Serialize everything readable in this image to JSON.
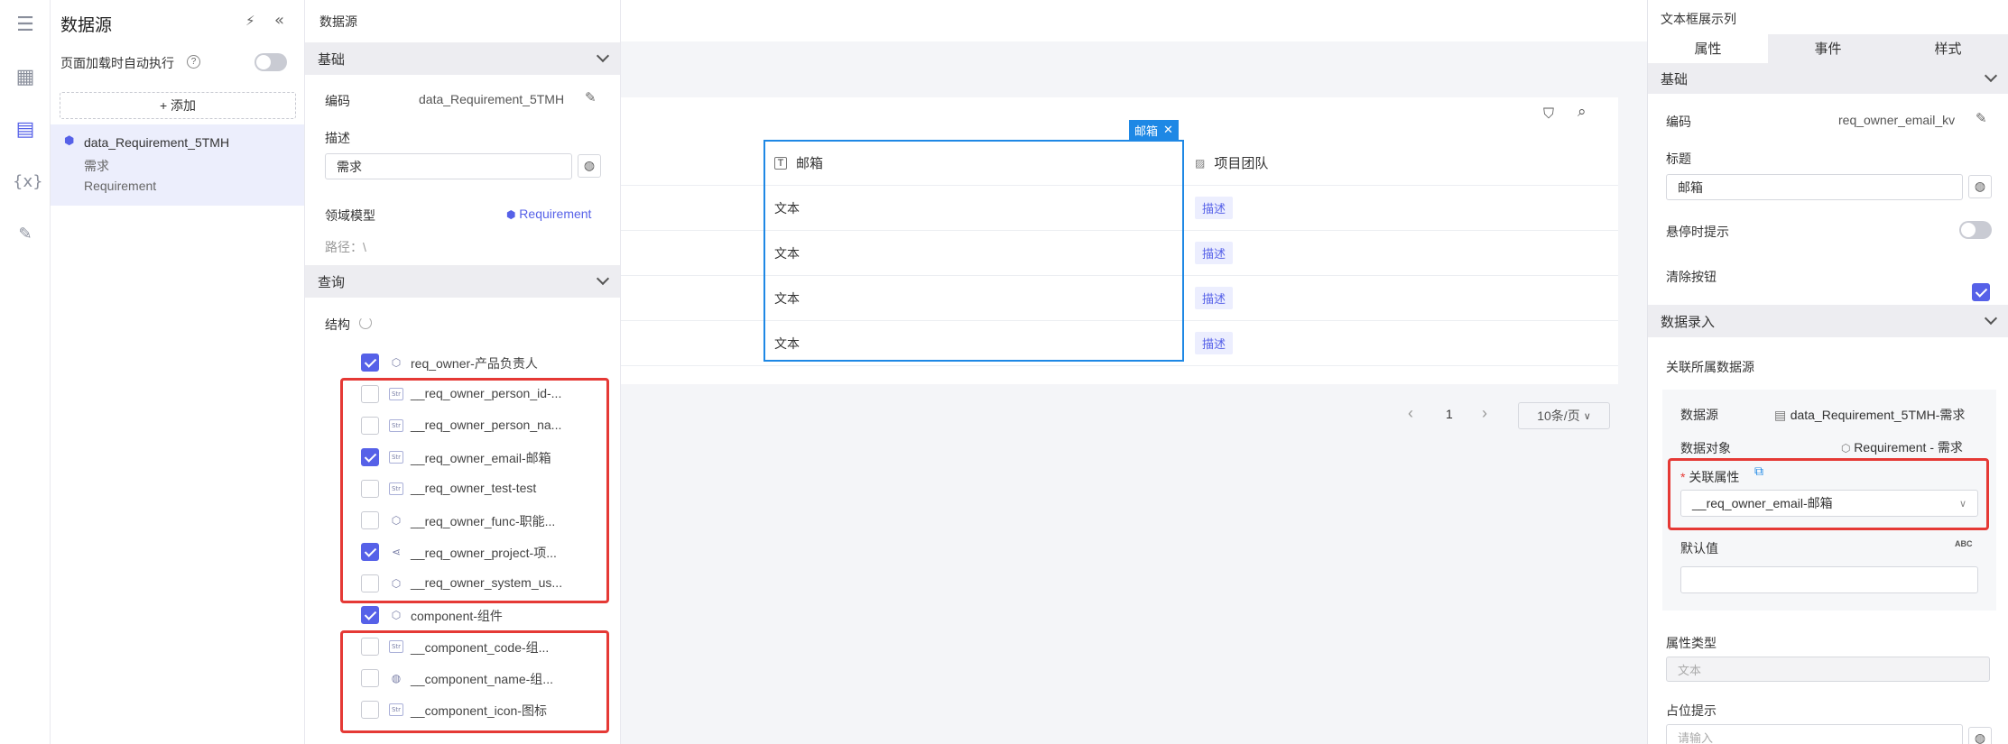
{
  "datasource_panel": {
    "title": "数据源",
    "auto_exec_label": "页面加载时自动执行",
    "add_button": "+ 添加",
    "item": {
      "code": "data_Requirement_5TMH",
      "name": "需求",
      "model": "Requirement"
    }
  },
  "mid_panel": {
    "title": "数据源",
    "basic_section": "基础",
    "code_label": "编码",
    "code_value": "data_Requirement_5TMH",
    "desc_label": "描述",
    "desc_value": "需求",
    "domain_label": "领域模型",
    "domain_value": "Requirement",
    "path_label": "路径：\\",
    "query_section": "查询",
    "struct_label": "结构",
    "tree": [
      {
        "label": "req_owner-产品负责人",
        "checked": true,
        "icon": "obj"
      },
      {
        "label": "__req_owner_person_id-...",
        "checked": false,
        "icon": "str"
      },
      {
        "label": "__req_owner_person_na...",
        "checked": false,
        "icon": "str"
      },
      {
        "label": "__req_owner_email-邮箱",
        "checked": true,
        "icon": "str"
      },
      {
        "label": "__req_owner_test-test",
        "checked": false,
        "icon": "str"
      },
      {
        "label": "__req_owner_func-职能...",
        "checked": false,
        "icon": "obj"
      },
      {
        "label": "__req_owner_project-项...",
        "checked": true,
        "icon": "share"
      },
      {
        "label": "__req_owner_system_us...",
        "checked": false,
        "icon": "obj"
      },
      {
        "label": "component-组件",
        "checked": true,
        "icon": "obj"
      },
      {
        "label": "__component_code-组...",
        "checked": false,
        "icon": "str"
      },
      {
        "label": "__component_name-组...",
        "checked": false,
        "icon": "globe"
      },
      {
        "label": "__component_icon-图标",
        "checked": false,
        "icon": "str"
      }
    ],
    "str_icon_text": "Str"
  },
  "canvas": {
    "selected_badge": "邮箱",
    "columns": [
      {
        "name": "邮箱"
      },
      {
        "name": "项目团队"
      }
    ],
    "rows": [
      {
        "email": "文本",
        "team": "描述"
      },
      {
        "email": "文本",
        "team": "描述"
      },
      {
        "email": "文本",
        "team": "描述"
      },
      {
        "email": "文本",
        "team": "描述"
      }
    ],
    "pagination": {
      "page": "1",
      "page_size": "10条/页"
    }
  },
  "right_panel": {
    "title": "文本框展示列",
    "tabs": [
      "属性",
      "事件",
      "样式"
    ],
    "basic_section": "基础",
    "code_label": "编码",
    "code_value": "req_owner_email_kv",
    "title_label": "标题",
    "title_value": "邮箱",
    "hover_label": "悬停时提示",
    "clear_label": "清除按钮",
    "data_entry_section": "数据录入",
    "link_ds_label": "关联所属数据源",
    "ds_label": "数据源",
    "ds_value": "data_Requirement_5TMH-需求",
    "obj_label": "数据对象",
    "obj_value": "Requirement - 需求",
    "attr_label": "关联属性",
    "attr_required": "*",
    "attr_value": "__req_owner_email-邮箱",
    "default_label": "默认值",
    "default_badge": "ABC",
    "attr_type_label": "属性类型",
    "attr_type_value": "文本",
    "placeholder_label": "占位提示",
    "placeholder_value": "请输入"
  },
  "colors": {
    "accent": "#5661e8",
    "selection": "#1e88e5",
    "highlight": "#e53935"
  }
}
